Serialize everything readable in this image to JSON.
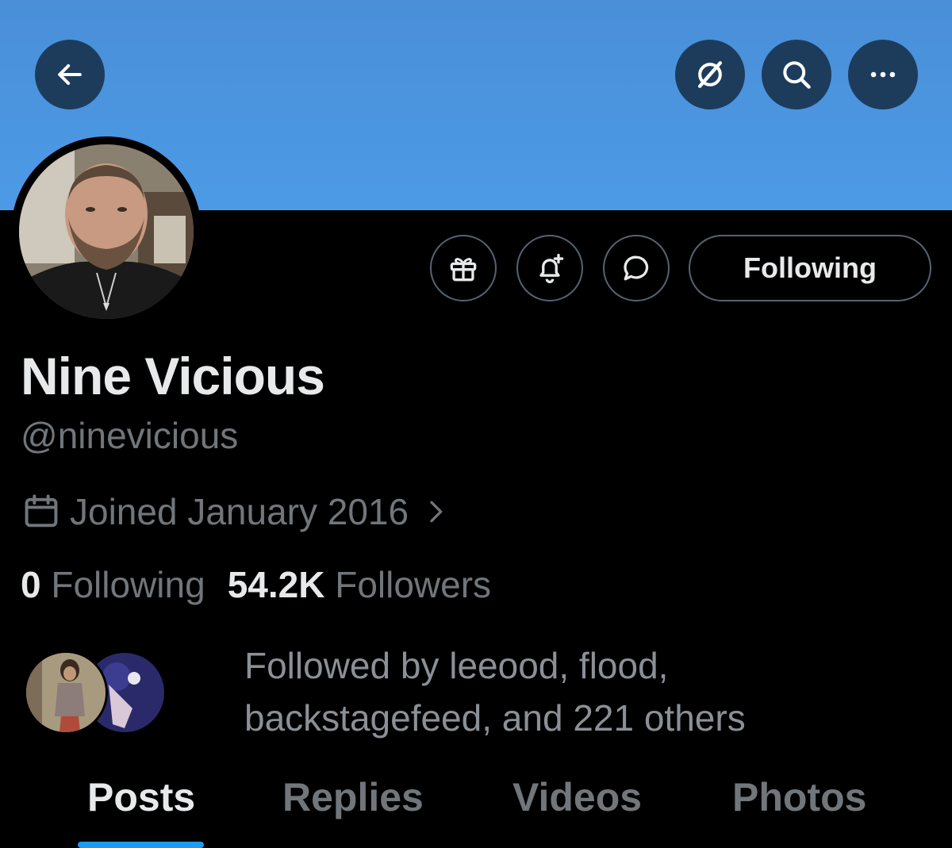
{
  "header": {
    "back_icon": "arrow-left-icon",
    "grok_icon": "grok-slash-icon",
    "search_icon": "search-icon",
    "more_icon": "more-horizontal-icon",
    "banner_color": "#4c9ae6"
  },
  "profile": {
    "display_name": "Nine Vicious",
    "handle": "@ninevicious",
    "joined": "Joined January 2016",
    "following_count": "0",
    "following_label": "Following",
    "followers_count": "54.2K",
    "followers_label": "Followers",
    "followed_by": "Followed by leeood, flood, backstagefeed, and 221 others"
  },
  "actions": {
    "gift_icon": "gift-icon",
    "notify_icon": "bell-plus-icon",
    "message_icon": "message-bubble-icon",
    "follow_button_label": "Following"
  },
  "tabs": [
    {
      "label": "Posts",
      "active": true
    },
    {
      "label": "Replies",
      "active": false
    },
    {
      "label": "Videos",
      "active": false
    },
    {
      "label": "Photos",
      "active": false
    }
  ],
  "colors": {
    "accent": "#1d9bf0",
    "background": "#000000",
    "muted_text": "#71767b"
  }
}
